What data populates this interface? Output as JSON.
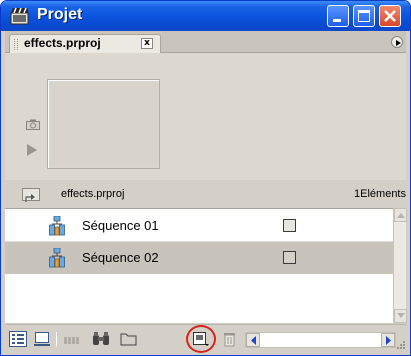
{
  "window": {
    "title": "Projet"
  },
  "tab": {
    "label": "effects.prproj",
    "close_glyph": "x"
  },
  "path": {
    "name": "effects.prproj",
    "count": "1Eléments"
  },
  "items": [
    {
      "label": "Séquence 01",
      "icon": "sequence-icon"
    },
    {
      "label": "Séquence 02",
      "icon": "sequence-icon"
    }
  ],
  "toolbar": {
    "buttons": [
      "list-view-icon",
      "icon-view-icon",
      "automate-to-sequence-icon",
      "find-icon",
      "new-bin-icon",
      "new-item-icon",
      "clear-icon"
    ]
  },
  "colors": {
    "titlebar": "#0b55e0",
    "selected_row": "#c8c4bc",
    "highlight_circle": "#d8231a"
  }
}
